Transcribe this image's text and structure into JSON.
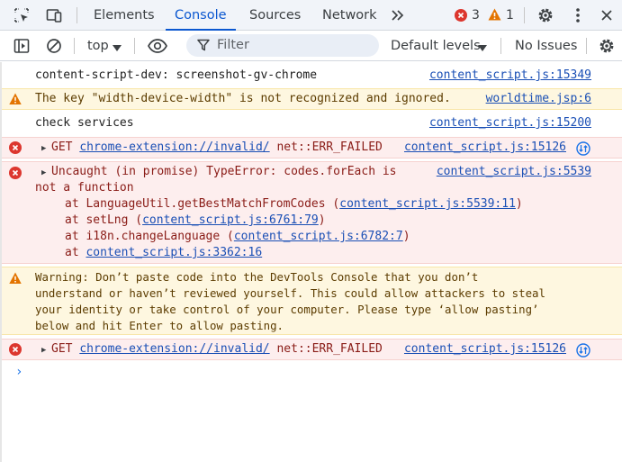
{
  "tabs": {
    "elements": "Elements",
    "console": "Console",
    "sources": "Sources",
    "network": "Network",
    "error_count": "3",
    "warning_count": "1"
  },
  "toolbar": {
    "context": "top",
    "filter_placeholder": "Filter",
    "levels": "Default levels",
    "issues": "No Issues"
  },
  "messages": {
    "m1": {
      "text": "content-script-dev: screenshot-gv-chrome",
      "source": "content_script.js:15349"
    },
    "m2": {
      "text": "The key \"width-device-width\" is not recognized and ignored.",
      "source": "worldtime.jsp:6"
    },
    "m3": {
      "text": "check services",
      "source": "content_script.js:15200"
    },
    "m4": {
      "method": "GET",
      "url": "chrome-extension://invalid/",
      "status": "net::ERR_FAILED",
      "source": "content_script.js:15126"
    },
    "m5": {
      "line1": "Uncaught (in promise) TypeError: codes.forEach is",
      "line2": "not a function",
      "source": "content_script.js:5539",
      "stack": [
        {
          "prefix": "at LanguageUtil.getBestMatchFromCodes (",
          "link": "content_script.js:5539:11",
          "suffix": ")"
        },
        {
          "prefix": "at setLng (",
          "link": "content_script.js:6761:79",
          "suffix": ")"
        },
        {
          "prefix": "at i18n.changeLanguage (",
          "link": "content_script.js:6782:7",
          "suffix": ")"
        },
        {
          "prefix": "at ",
          "link": "content_script.js:3362:16",
          "suffix": ""
        }
      ]
    },
    "m6": {
      "lines": [
        "Warning: Don’t paste code into the DevTools Console that you don’t",
        "understand or haven’t reviewed yourself. This could allow attackers to steal",
        "your identity or take control of your computer. Please type ‘allow pasting’",
        "below and hit Enter to allow pasting."
      ]
    },
    "m7": {
      "method": "GET",
      "url": "chrome-extension://invalid/",
      "status": "net::ERR_FAILED",
      "source": "content_script.js:15126"
    }
  },
  "prompt_symbol": "›",
  "colors": {
    "accent": "#0b57d0",
    "error": "#dc362e",
    "warning": "#e37400",
    "link": "#1a4fb5"
  }
}
